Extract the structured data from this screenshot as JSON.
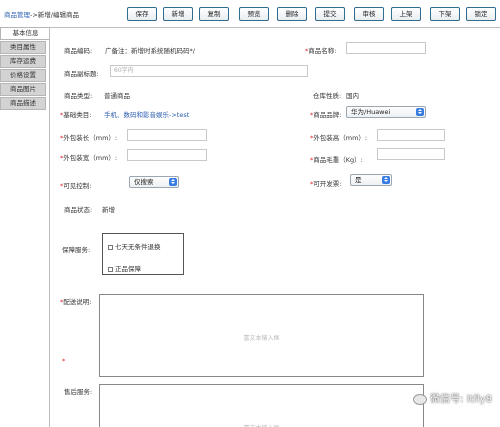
{
  "breadcrumb": {
    "link": "商品管理",
    "rest": "->新增/编辑商品"
  },
  "toolbar": [
    "保存",
    "新增",
    "复制",
    "预览",
    "删除",
    "提交",
    "审核",
    "上架",
    "下架",
    "锁定"
  ],
  "tabs": [
    "基本信息",
    "类目属性",
    "库存运费",
    "价格设置",
    "商品图片",
    "商品描述"
  ],
  "form": {
    "code_label": "商品编码:",
    "code_note": "广备注：新增时系统随机码码*/",
    "name_label": "商品名称:",
    "subtitle_label": "商品副标题:",
    "subtitle_placeholder": "60字内",
    "type_label": "商品类型:",
    "type_value": "普通商品",
    "warehouse_label": "仓库性质:",
    "warehouse_value": "国内",
    "category_label": "基础类目:",
    "category_value": "手机、数码和影音娱乐->test",
    "brand_label": "商品品牌:",
    "brand_value": "华为/Huawei",
    "pkg_length_label": "外包装长（mm）:",
    "pkg_height_label": "外包装高（mm）:",
    "pkg_width_label": "外包装宽（mm）:",
    "gross_weight_label": "商品毛重（Kg）:",
    "visibility_label": "可见控制:",
    "visibility_value": "仅搜索",
    "invoice_label": "可开发票:",
    "invoice_value": "是",
    "status_label": "商品状态:",
    "status_value": "新增",
    "guarantee_label": "保障服务:",
    "guarantee_options": [
      "七天无条件退换",
      "正品保障"
    ],
    "delivery_label": "配送说明:",
    "editor_placeholder": "富文本输入框",
    "aftersale_label": "售后服务:",
    "required_mark": "*"
  },
  "watermark": "微信号: itfly8"
}
